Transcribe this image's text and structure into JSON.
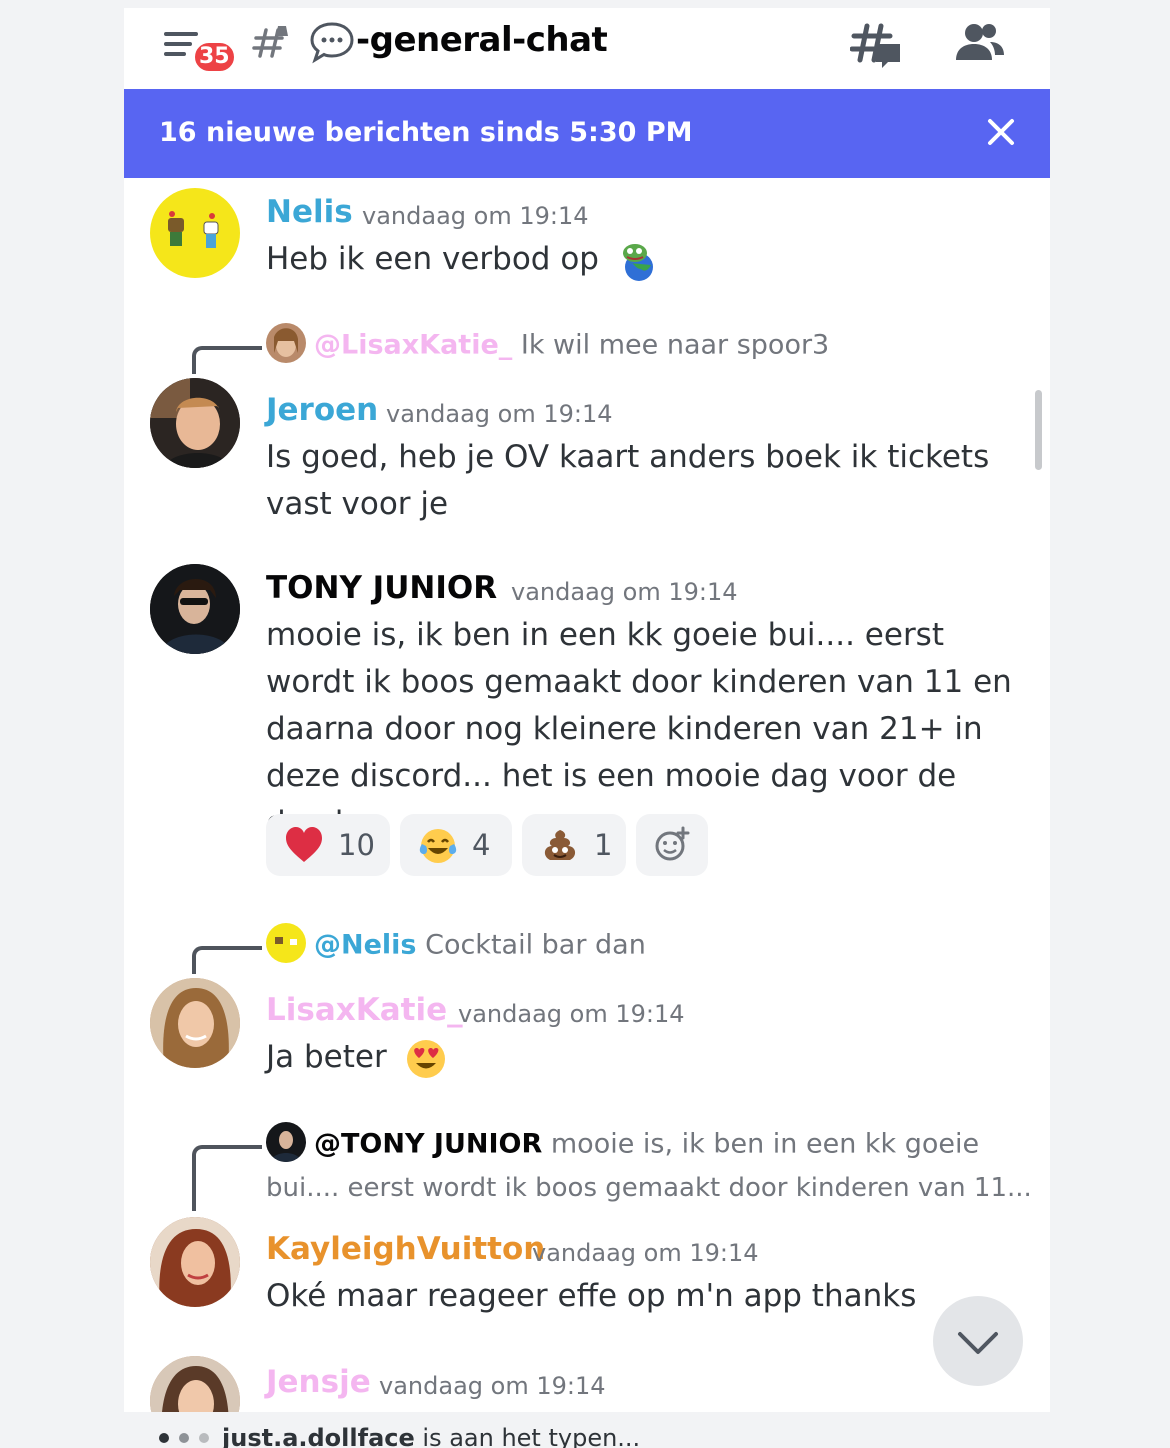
{
  "header": {
    "unread_count": "35",
    "channel_name": "-general-chat"
  },
  "new_messages_bar": {
    "text": "16 nieuwe berichten sinds 5:30 PM"
  },
  "colors": {
    "blurple": "#5865f2",
    "name_nelis": "#3ba7d6",
    "name_jeroen": "#3ba7d6",
    "name_tony": "#060607",
    "name_lisa": "#f4b6f0",
    "name_kayleigh": "#e8922c",
    "name_jensje": "#f4b6f0"
  },
  "messages": [
    {
      "author": "Nelis",
      "timestamp": "vandaag om 19:14",
      "text": "Heb ik een verbod op",
      "emoji": "pepe-on-globe-emoji"
    },
    {
      "reply_to_name": "@LisaxKatie_",
      "reply_to_text": "Ik wil mee naar spoor3",
      "author": "Jeroen",
      "timestamp": "vandaag om 19:14",
      "text": "Is goed, heb je OV kaart anders boek ik tickets vast voor je"
    },
    {
      "author": "TONY JUNIOR",
      "timestamp": "vandaag om 19:14",
      "text": "mooie is, ik ben in een kk goeie bui.... eerst wordt ik boos gemaakt door kinderen van 11 en daarna door nog kleinere kinderen van 21+ in deze discord... het is een mooie dag voor de dood",
      "reactions": [
        {
          "emoji": "red-heart",
          "count": "10"
        },
        {
          "emoji": "tears-of-joy",
          "count": "4"
        },
        {
          "emoji": "pile-of-poo",
          "count": "1"
        }
      ]
    },
    {
      "reply_to_name": "@Nelis",
      "reply_to_text": "Cocktail bar dan",
      "author": "LisaxKatie_",
      "timestamp": "vandaag om 19:14",
      "text": "Ja beter",
      "emoji": "heart-eyes"
    },
    {
      "reply_to_name": "@TONY JUNIOR",
      "reply_to_text_1": "mooie is, ik ben in een kk goeie",
      "reply_to_text_2": "bui.... eerst wordt ik boos gemaakt door kinderen van 11...",
      "author": "KayleighVuitton",
      "timestamp": "vandaag om 19:14",
      "text": "Oké maar reageer effe op m'n app thanks"
    },
    {
      "author": "Jensje",
      "timestamp": "vandaag om 19:14"
    }
  ],
  "typing": {
    "user": "just.a.dollface",
    "suffix": " is aan het typen..."
  }
}
